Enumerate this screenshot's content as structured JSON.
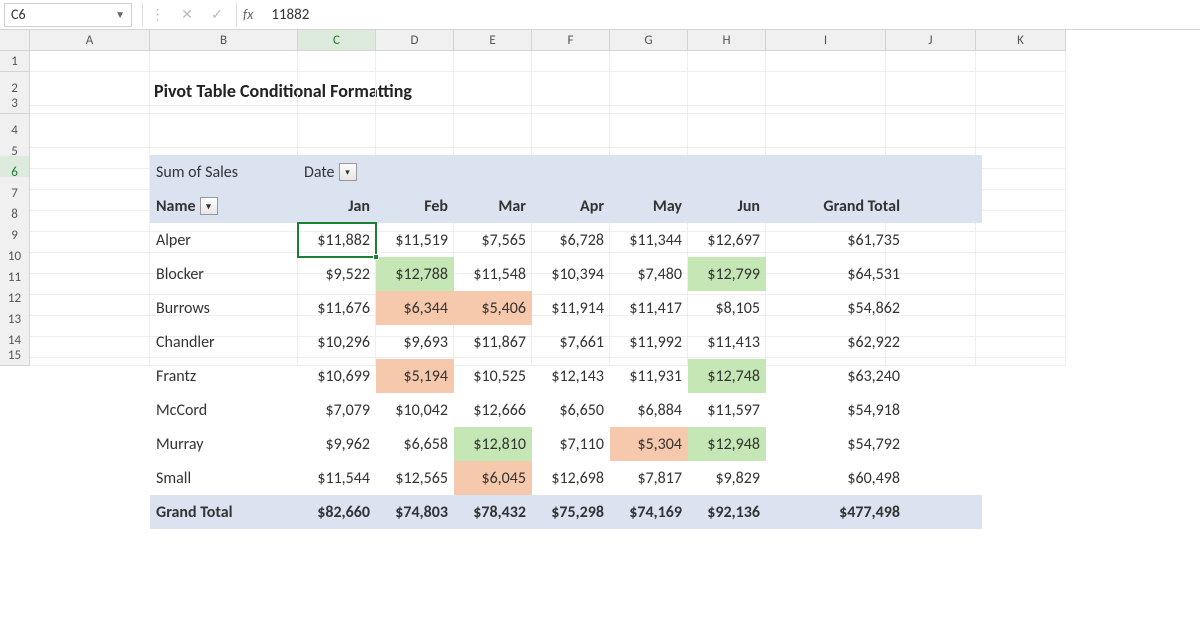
{
  "name_box": "C6",
  "formula_value": "11882",
  "columns": [
    "A",
    "B",
    "C",
    "D",
    "E",
    "F",
    "G",
    "H",
    "I",
    "J",
    "K"
  ],
  "rows": [
    "1",
    "2",
    "3",
    "4",
    "5",
    "6",
    "7",
    "8",
    "9",
    "10",
    "11",
    "12",
    "13",
    "14",
    "15"
  ],
  "title": "Pivot Table Conditional Formatting",
  "pivot": {
    "sum_label": "Sum of Sales",
    "date_label": "Date",
    "name_label": "Name",
    "months": [
      "Jan",
      "Feb",
      "Mar",
      "Apr",
      "May",
      "Jun"
    ],
    "grand_total_label": "Grand Total",
    "rows": [
      {
        "name": "Alper",
        "vals": [
          "$11,882",
          "$11,519",
          "$7,565",
          "$6,728",
          "$11,344",
          "$12,697"
        ],
        "total": "$61,735",
        "hl": [
          "",
          "",
          "",
          "",
          "",
          ""
        ]
      },
      {
        "name": "Blocker",
        "vals": [
          "$9,522",
          "$12,788",
          "$11,548",
          "$10,394",
          "$7,480",
          "$12,799"
        ],
        "total": "$64,531",
        "hl": [
          "",
          "g",
          "",
          "",
          "",
          "g"
        ]
      },
      {
        "name": "Burrows",
        "vals": [
          "$11,676",
          "$6,344",
          "$5,406",
          "$11,914",
          "$11,417",
          "$8,105"
        ],
        "total": "$54,862",
        "hl": [
          "",
          "o",
          "o",
          "",
          "",
          ""
        ]
      },
      {
        "name": "Chandler",
        "vals": [
          "$10,296",
          "$9,693",
          "$11,867",
          "$7,661",
          "$11,992",
          "$11,413"
        ],
        "total": "$62,922",
        "hl": [
          "",
          "",
          "",
          "",
          "",
          ""
        ]
      },
      {
        "name": "Frantz",
        "vals": [
          "$10,699",
          "$5,194",
          "$10,525",
          "$12,143",
          "$11,931",
          "$12,748"
        ],
        "total": "$63,240",
        "hl": [
          "",
          "o",
          "",
          "",
          "",
          "g"
        ]
      },
      {
        "name": "McCord",
        "vals": [
          "$7,079",
          "$10,042",
          "$12,666",
          "$6,650",
          "$6,884",
          "$11,597"
        ],
        "total": "$54,918",
        "hl": [
          "",
          "",
          "",
          "",
          "",
          ""
        ]
      },
      {
        "name": "Murray",
        "vals": [
          "$9,962",
          "$6,658",
          "$12,810",
          "$7,110",
          "$5,304",
          "$12,948"
        ],
        "total": "$54,792",
        "hl": [
          "",
          "",
          "g",
          "",
          "o",
          "g"
        ]
      },
      {
        "name": "Small",
        "vals": [
          "$11,544",
          "$12,565",
          "$6,045",
          "$12,698",
          "$7,817",
          "$9,829"
        ],
        "total": "$60,498",
        "hl": [
          "",
          "",
          "o",
          "",
          "",
          ""
        ]
      }
    ],
    "col_totals": [
      "$82,660",
      "$74,803",
      "$78,432",
      "$75,298",
      "$74,169",
      "$92,136"
    ],
    "grand_total": "$477,498"
  },
  "active_col": "C",
  "active_row": "6"
}
